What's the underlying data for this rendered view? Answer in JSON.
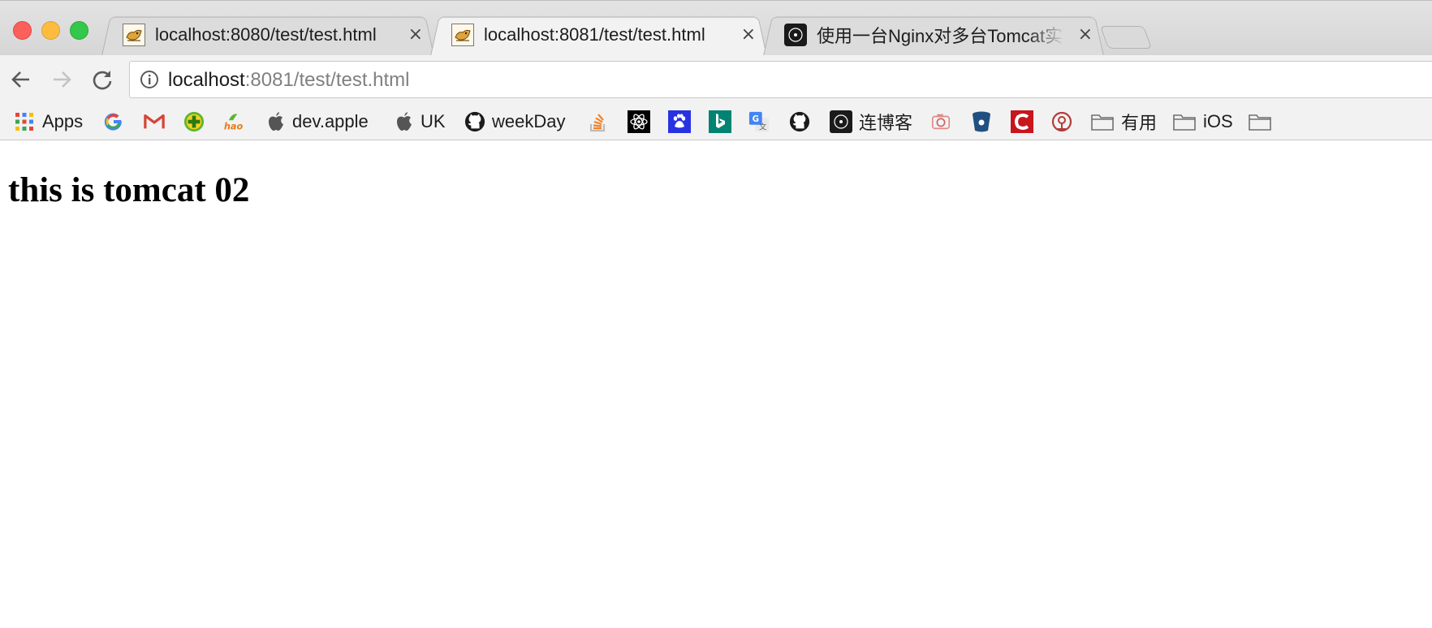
{
  "tabs": [
    {
      "title": "localhost:8080/test/test.html",
      "icon": "tomcat-favicon",
      "active": false
    },
    {
      "title": "localhost:8081/test/test.html",
      "icon": "tomcat-favicon",
      "active": true
    },
    {
      "title": "使用一台Nginx对多台Tomcat实现",
      "icon": "lyc-favicon",
      "active": false
    }
  ],
  "tab_close_glyph": "×",
  "address_bar": {
    "host": "localhost",
    "rest": ":8081/test/test.html"
  },
  "bookmarks": {
    "apps": "Apps",
    "dev_apple": "dev.apple",
    "uk": "UK",
    "weekday": "weekDay",
    "lianboke": "连博客",
    "youyong": "有用",
    "ios": "iOS"
  },
  "page": {
    "heading": "this is tomcat 02"
  },
  "colors": {
    "close": "#fc605b",
    "minimize": "#fdbc40",
    "maximize": "#34c84a",
    "url_rest": "#808080",
    "gmail_red": "#d44638",
    "bing_teal": "#008373"
  }
}
